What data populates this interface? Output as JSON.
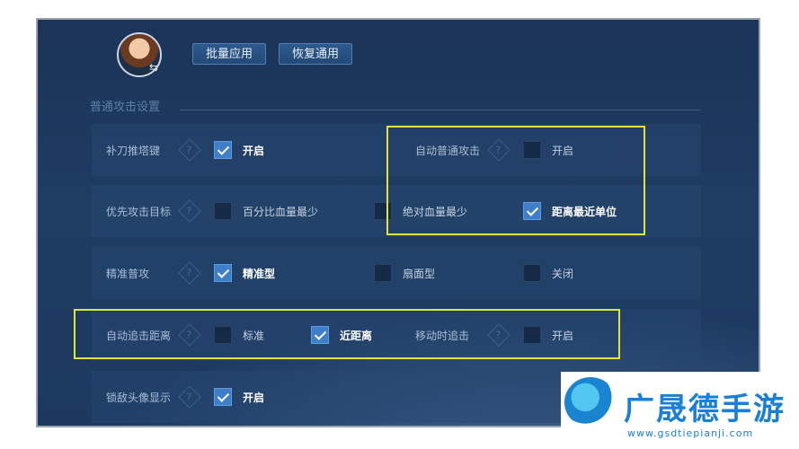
{
  "toolbar": {
    "batch_apply": "批量应用",
    "restore_default": "恢复通用"
  },
  "section": {
    "title": "普通攻击设置"
  },
  "rows": {
    "r1": {
      "left_label": "补刀推塔键",
      "left_option": {
        "label": "开启",
        "checked": true
      },
      "right_label": "自动普通攻击",
      "right_option": {
        "label": "开启",
        "checked": false
      }
    },
    "r2": {
      "label": "优先攻击目标",
      "options": [
        {
          "label": "百分比血量最少",
          "checked": false
        },
        {
          "label": "绝对血量最少",
          "checked": false
        },
        {
          "label": "距离最近单位",
          "checked": true
        }
      ]
    },
    "r3": {
      "label": "精准普攻",
      "options": [
        {
          "label": "精准型",
          "checked": true
        },
        {
          "label": "扇面型",
          "checked": false
        },
        {
          "label": "关闭",
          "checked": false
        }
      ]
    },
    "r4": {
      "left_label": "自动追击距离",
      "options": [
        {
          "label": "标准",
          "checked": false
        },
        {
          "label": "近距离",
          "checked": true
        }
      ],
      "right_label": "移动时追击",
      "right_option": {
        "label": "开启",
        "checked": false
      }
    },
    "r5": {
      "label": "锁敌头像显示",
      "option": {
        "label": "开启",
        "checked": true
      }
    }
  },
  "help_glyph": "?",
  "swap_glyph": "⇆",
  "watermark": {
    "name": "广晟德手游",
    "url": "www.gsdtiepianji.com"
  },
  "colors": {
    "highlight": "#e3e43a",
    "checkbox_on": "#3f7fc8",
    "panel_bg": "#1f3c63",
    "brand": "#1a7fd6"
  }
}
